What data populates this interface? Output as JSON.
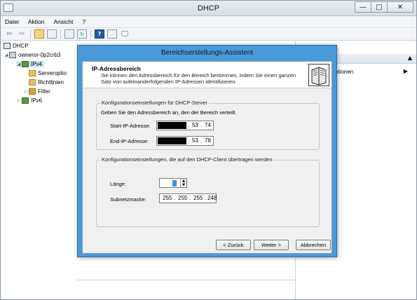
{
  "window": {
    "title": "DHCP",
    "buttons": {
      "minimize": "—",
      "maximize": "□",
      "close": "✕"
    }
  },
  "menu": [
    "Datei",
    "Aktion",
    "Ansicht",
    "?"
  ],
  "toolbar": {
    "icons": [
      "back-arrow-icon",
      "forward-arrow-icon",
      "up-folder-icon",
      "show-tree-icon",
      "properties-icon",
      "refresh-icon",
      "help-icon",
      "panel-icon",
      "monitor-icon"
    ],
    "help_label": "?"
  },
  "tree": {
    "root": "DHCP",
    "server": "owneror-0p2crb3",
    "ipv4": "IPv4",
    "serveroptions": "Serveroptio",
    "policies": "Richtlinien",
    "filter": "Filter",
    "ipv6": "IPv6",
    "expand_open": "◢",
    "expand_closed": "▷"
  },
  "actions_pane": {
    "item": "ptionen",
    "header_arrow": "▲",
    "item_arrow": "▶"
  },
  "dialog": {
    "title": "Bereichserstellungs-Assistent",
    "header_title": "IP-Adressbereich",
    "header_desc": "Sie können den Adressbereich für den Bereich bestimmen, indem Sie einen ganzen Satz von aufeinanderfolgenden IP-Adressen identifizieren.",
    "server_group": {
      "legend": "Konfigurationseinstellungen für DHCP-Server",
      "instruction": "Geben Sie den Adressbereich an, den der Bereich verteilt.",
      "start_label": "Start-IP-Adresse:",
      "start_octets": [
        "53",
        "74"
      ],
      "end_label": "End-IP-Adresse:",
      "end_octets": [
        "53",
        "78"
      ]
    },
    "client_group": {
      "legend": "Konfigurationseinstellungen, die auf den DHCP-Client übertragen werden",
      "length_label": "Länge:",
      "spin_up": "▲",
      "spin_down": "▼",
      "subnet_label": "Subnetzmaske:",
      "subnet_octets": [
        "255",
        "255",
        "255",
        "248"
      ]
    },
    "buttons": {
      "back": "< Zurück",
      "next": "Weiter >",
      "cancel": "Abbrechen"
    }
  }
}
